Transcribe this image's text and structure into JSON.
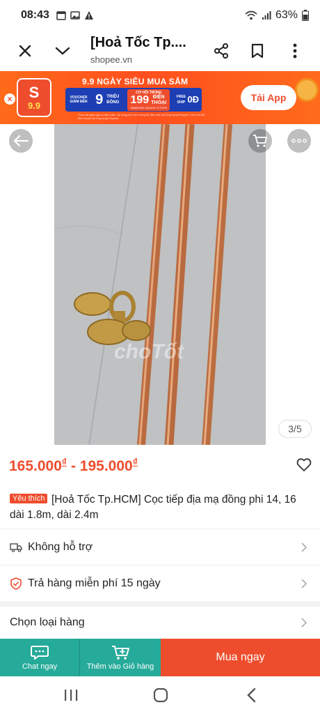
{
  "status_bar": {
    "time": "08:43",
    "battery": "63%",
    "icons": [
      "calendar-icon",
      "image-icon",
      "warning-icon",
      "wifi-icon",
      "signal-icon",
      "battery-icon"
    ]
  },
  "browser": {
    "title": "[Hoả Tốc Tp....",
    "url": "shopee.vn",
    "icons": [
      "close-icon",
      "chevron-down-icon",
      "share-icon",
      "bookmark-icon",
      "more-vert-icon"
    ]
  },
  "banner": {
    "logo_number": "9.9",
    "headline": "9.9 NGÀY SIÊU MUA SẮM",
    "voucher_label": "VOUCHER GIẢM ĐẾN",
    "voucher_value": "9",
    "voucher_unit": "TRIỆU ĐỒNG",
    "chance_label": "CƠ HỘI TRÚNG",
    "phones_value": "199",
    "phones_unit": "ĐIỆN THOẠI",
    "phones_model": "SAMSUNG GALAXY Z FLIP6",
    "ship_label": "FREE SHIP",
    "ship_value": "0Đ",
    "fine_print": "*Các mã giảm giá có điều kiện. Áp dụng cho đơn hàng đủ điều kiện tại Ứng dụng Shopee. Xem chi tiết điều khoản tại ứng dụng Shopee.",
    "install_label": "Tải App",
    "accent": "#ee4d2d"
  },
  "gallery": {
    "counter": "3/5",
    "watermark": "choTốt",
    "icons": [
      "arrow-left-icon",
      "cart-icon",
      "more-horiz-icon"
    ]
  },
  "product": {
    "price_min": "165.000",
    "price_max": "195.000",
    "currency": "₫",
    "price_separator": "-",
    "badge": "Yêu thích",
    "title": "[Hoả Tốc Tp.HCM] Cọc tiếp địa mạ đồng phi 14, 16 dài 1.8m, dài 2.4m"
  },
  "rows": {
    "shipping": "Không hỗ trợ",
    "return": "Trả hàng miễn phí 15 ngày",
    "variant": "Chọn loại hàng"
  },
  "actions": {
    "chat": "Chat ngay",
    "add_to_cart": "Thêm vào Giỏ hàng",
    "buy_now": "Mua ngay",
    "chat_color": "#26aa99",
    "buy_color": "#ee4d2d"
  }
}
